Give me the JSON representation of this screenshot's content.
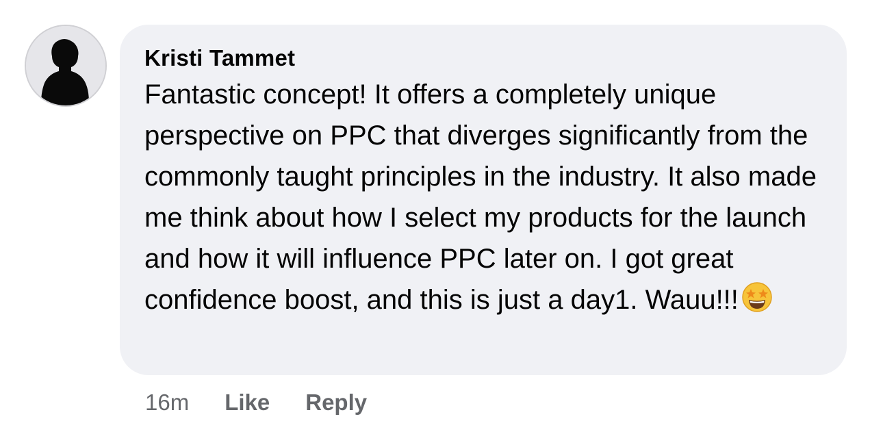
{
  "comment": {
    "author": "Kristi Tammet",
    "text": "Fantastic concept! It offers a completely unique perspective on PPC that diverges significantly from the commonly taught principles in the industry. It also made me think about how I select my products for the launch and how it will influence PPC later on. I got great confidence boost, and this is just a day1. Wauu!!!",
    "emoji": "star-struck-emoji",
    "timestamp": "16m",
    "like_label": "Like",
    "reply_label": "Reply"
  },
  "colors": {
    "bubble_background": "#f0f1f5",
    "text": "#050505",
    "secondary_text": "#65676b"
  }
}
